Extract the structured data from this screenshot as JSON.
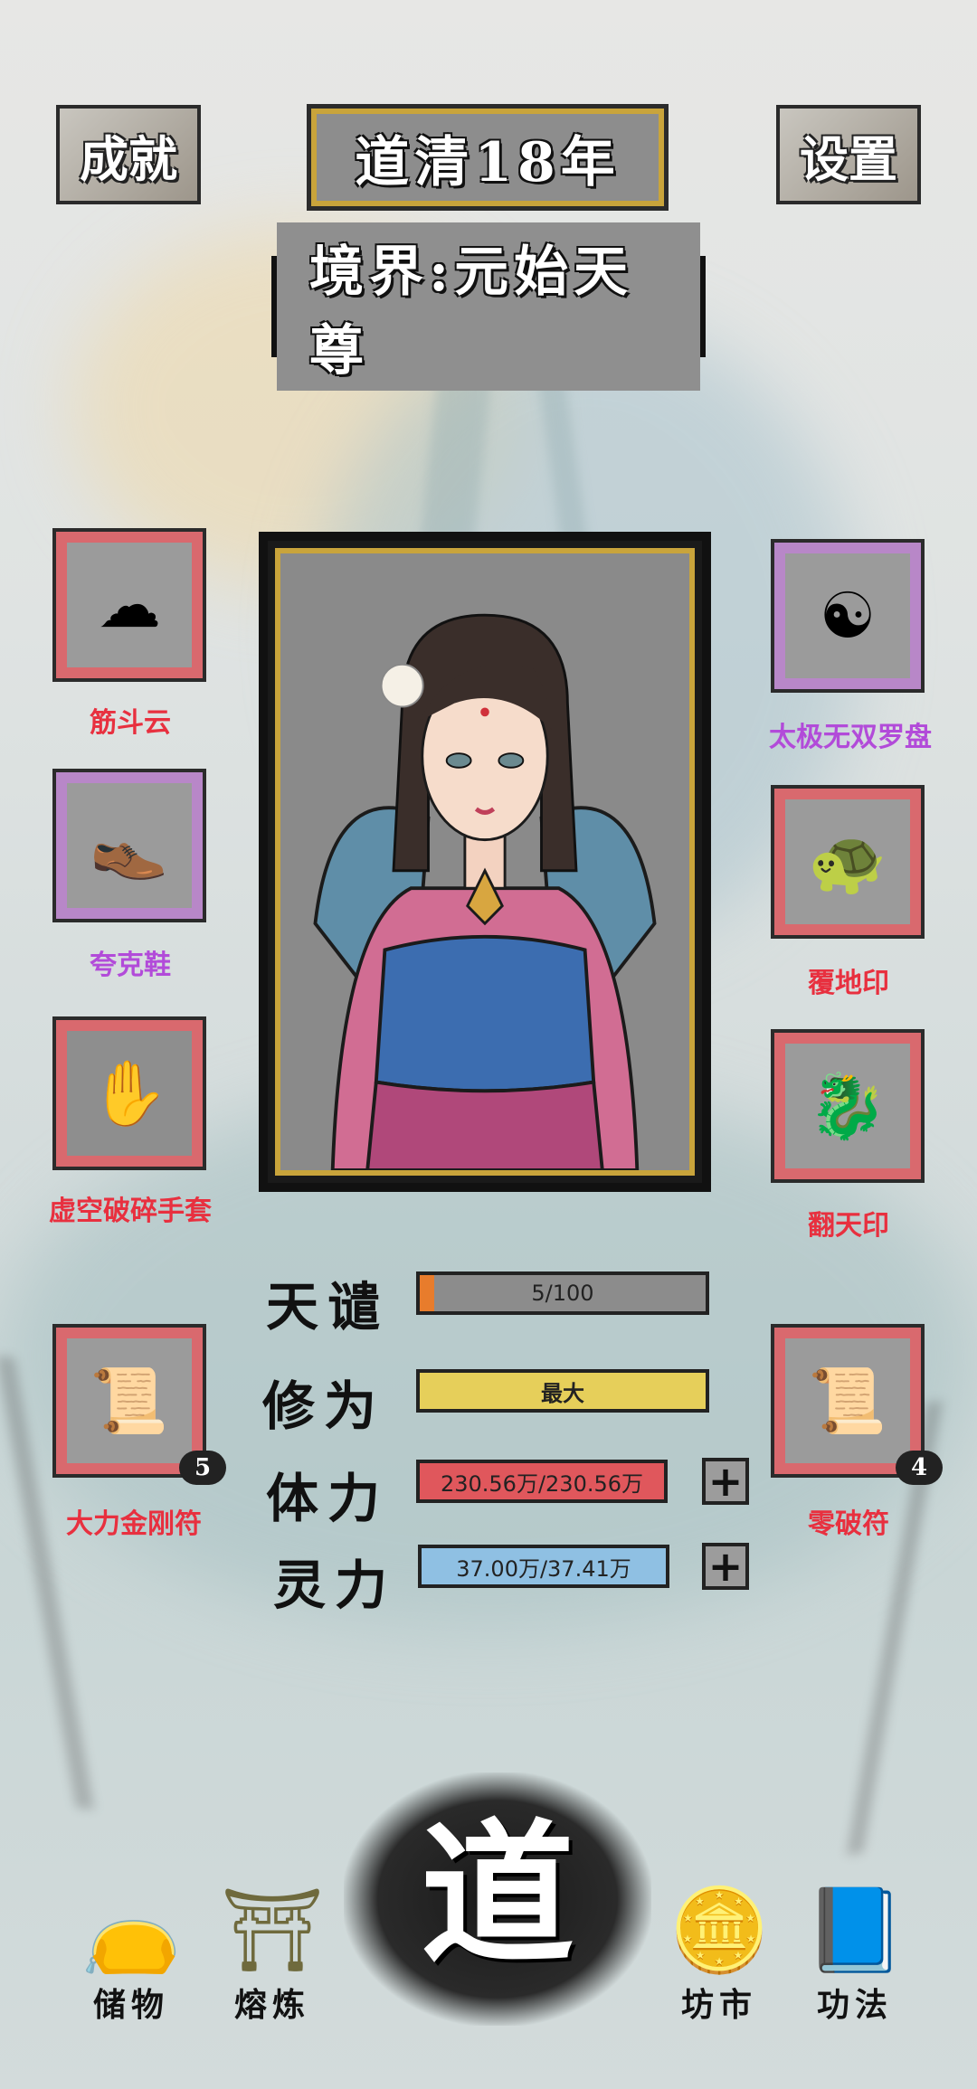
{
  "header": {
    "achievements_label": "成就",
    "year_label": "道清18年",
    "settings_label": "设置",
    "realm_label": "境界:元始天尊"
  },
  "left_slots": [
    {
      "label": "筋斗云",
      "label_color": "#e8303f",
      "frame": "red",
      "icon": "cloud-icon"
    },
    {
      "label": "夸克鞋",
      "label_color": "#b24bd9",
      "frame": "purple",
      "icon": "shoe-icon"
    },
    {
      "label": "虚空破碎手套",
      "label_color": "#e8303f",
      "frame": "red",
      "icon": "glove-icon"
    },
    {
      "label": "大力金刚符",
      "label_color": "#e8303f",
      "frame": "red",
      "icon": "talisman-icon",
      "count": "5"
    }
  ],
  "right_slots": [
    {
      "label": "太极无双罗盘",
      "label_color": "#b24bd9",
      "frame": "purple",
      "icon": "compass-icon"
    },
    {
      "label": "覆地印",
      "label_color": "#e8303f",
      "frame": "red",
      "icon": "seal-icon"
    },
    {
      "label": "翻天印",
      "label_color": "#e8303f",
      "frame": "red",
      "icon": "dragon-seal-icon"
    },
    {
      "label": "零破符",
      "label_color": "#e8303f",
      "frame": "red",
      "icon": "talisman-icon",
      "count": "4"
    }
  ],
  "stats": {
    "tribulation": {
      "label": "天谴",
      "value": "5/100",
      "fraction": 0.05,
      "color": "#8c8c8c"
    },
    "cultivation": {
      "label": "修为",
      "value": "最大",
      "fraction": 1.0,
      "color": "#e6cf5a"
    },
    "stamina": {
      "label": "体力",
      "value": "230.56万/230.56万",
      "fraction": 1.0,
      "color": "#e0575c"
    },
    "spirit": {
      "label": "灵力",
      "value": "37.00万/37.41万",
      "fraction": 0.99,
      "color": "#8fc0e3"
    }
  },
  "bottom_nav": {
    "storage": "储物",
    "smelting": "熔炼",
    "center": "道",
    "market": "坊市",
    "techniques": "功法"
  }
}
